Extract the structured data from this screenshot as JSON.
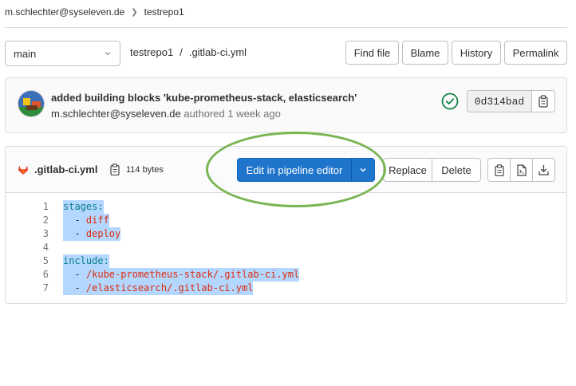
{
  "breadcrumb": {
    "user": "m.schlechter@syseleven.de",
    "repo": "testrepo1"
  },
  "branch": {
    "selected": "main"
  },
  "path": {
    "repo": "testrepo1",
    "separator": "/",
    "file": ".gitlab-ci.yml"
  },
  "toolbar": {
    "find_file": "Find file",
    "blame": "Blame",
    "history": "History",
    "permalink": "Permalink"
  },
  "commit": {
    "title": "added building blocks 'kube-prometheus-stack, elasticsearch'",
    "author": "m.schlechter@syseleven.de",
    "authored_text": "authored 1 week ago",
    "sha": "0d314bad",
    "status": "passed"
  },
  "file": {
    "name": ".gitlab-ci.yml",
    "size": "114 bytes",
    "edit_label": "Edit in pipeline editor",
    "replace_label": "Replace",
    "delete_label": "Delete"
  },
  "code": {
    "lines": [
      {
        "num": "1",
        "indent": "",
        "dash": "",
        "text": "stages:",
        "kind": "key"
      },
      {
        "num": "2",
        "indent": "  ",
        "dash": "- ",
        "text": "diff",
        "kind": "str"
      },
      {
        "num": "3",
        "indent": "  ",
        "dash": "- ",
        "text": "deploy",
        "kind": "str"
      },
      {
        "num": "4",
        "indent": "",
        "dash": "",
        "text": "",
        "kind": "blank"
      },
      {
        "num": "5",
        "indent": "",
        "dash": "",
        "text": "include:",
        "kind": "key"
      },
      {
        "num": "6",
        "indent": "  ",
        "dash": "- ",
        "text": "/kube-prometheus-stack/.gitlab-ci.yml",
        "kind": "str"
      },
      {
        "num": "7",
        "indent": "  ",
        "dash": "- ",
        "text": "/elasticsearch/.gitlab-ci.yml",
        "kind": "str"
      }
    ]
  },
  "colors": {
    "primary": "#1f75cb",
    "success": "#108548",
    "highlight": "#b3d7fe",
    "annotation": "#79b553"
  },
  "icons": [
    "chevron-right-icon",
    "chevron-down-icon",
    "avatar",
    "status-success-icon",
    "copy-icon",
    "gitlab-icon",
    "copy-contents-icon",
    "raw-file-icon",
    "download-icon"
  ]
}
